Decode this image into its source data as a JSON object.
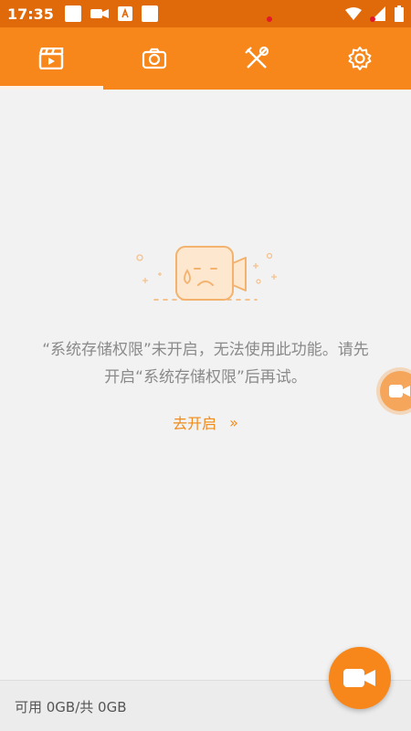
{
  "status_bar": {
    "time": "17:35",
    "icons": [
      "notification-square-icon",
      "video-icon",
      "a-icon",
      "notification-square-icon",
      "wifi-icon",
      "signal-icon",
      "battery-icon"
    ]
  },
  "tabs": [
    {
      "icon": "video-clapper-icon",
      "active": true,
      "badge": false
    },
    {
      "icon": "camera-icon",
      "active": false,
      "badge": false
    },
    {
      "icon": "tools-icon",
      "active": false,
      "badge": true
    },
    {
      "icon": "gear-icon",
      "active": false,
      "badge": true
    }
  ],
  "empty_state": {
    "message_line1": "“系统存储权限”未开启，无法使用此功能。请先",
    "message_line2": "开启“系统存储权限”后再试。",
    "open_label": "去开启",
    "open_arrow": "»"
  },
  "storage": {
    "text": "可用 0GB/共 0GB"
  },
  "colors": {
    "accent": "#f7871b",
    "status_bar": "#e06a0a",
    "message": "#8a8a8a",
    "link": "#f08a1a",
    "badge": "#e3192b"
  }
}
